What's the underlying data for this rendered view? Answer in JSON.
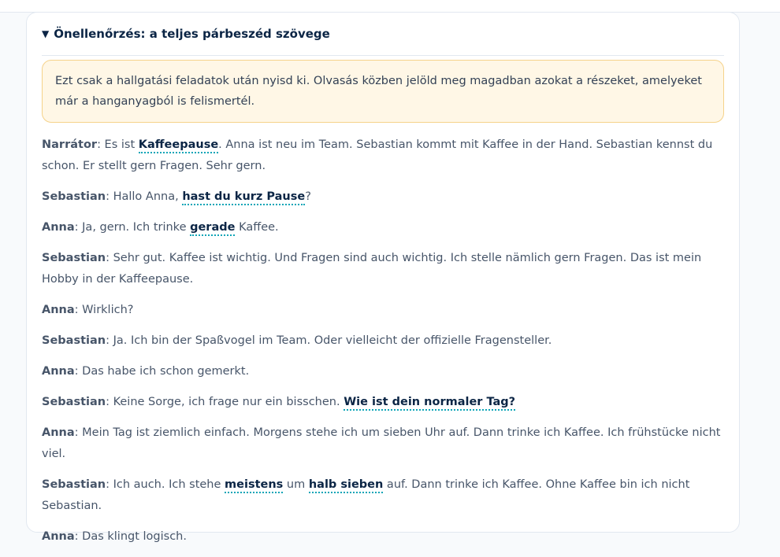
{
  "details": {
    "triangle": "▼",
    "title": "Önellenőrzés: a teljes párbeszéd szövege"
  },
  "note": "Ezt csak a hallgatási feladatok után nyisd ki. Olvasás közben jelöld meg magadban azokat a részeket, amelyeket már a hanganyagból is felismertél.",
  "dialog": [
    {
      "speaker": "Narrátor",
      "parts": [
        {
          "t": ": Es ist "
        },
        {
          "t": "Kaffeepause",
          "hl": true
        },
        {
          "t": ". Anna ist neu im Team. Sebastian kommt mit Kaffee in der Hand. Sebastian kennst du schon. Er stellt gern Fragen. Sehr gern."
        }
      ]
    },
    {
      "speaker": "Sebastian",
      "parts": [
        {
          "t": ": Hallo Anna, "
        },
        {
          "t": "hast du kurz Pause",
          "hl": true
        },
        {
          "t": "?"
        }
      ]
    },
    {
      "speaker": "Anna",
      "parts": [
        {
          "t": ": Ja, gern. Ich trinke "
        },
        {
          "t": "gerade",
          "hl": true
        },
        {
          "t": " Kaffee."
        }
      ]
    },
    {
      "speaker": "Sebastian",
      "parts": [
        {
          "t": ": Sehr gut. Kaffee ist wichtig. Und Fragen sind auch wichtig. Ich stelle nämlich gern Fragen. Das ist mein Hobby in der Kaffeepause."
        }
      ]
    },
    {
      "speaker": "Anna",
      "parts": [
        {
          "t": ": Wirklich?"
        }
      ]
    },
    {
      "speaker": "Sebastian",
      "parts": [
        {
          "t": ": Ja. Ich bin der Spaßvogel im Team. Oder vielleicht der offizielle Fragensteller."
        }
      ]
    },
    {
      "speaker": "Anna",
      "parts": [
        {
          "t": ": Das habe ich schon gemerkt."
        }
      ]
    },
    {
      "speaker": "Sebastian",
      "parts": [
        {
          "t": ": Keine Sorge, ich frage nur ein bisschen. "
        },
        {
          "t": "Wie ist dein normaler Tag?",
          "hl": true
        }
      ]
    },
    {
      "speaker": "Anna",
      "parts": [
        {
          "t": ": Mein Tag ist ziemlich einfach. Morgens stehe ich um sieben Uhr auf. Dann trinke ich Kaffee. Ich frühstücke nicht viel."
        }
      ]
    },
    {
      "speaker": "Sebastian",
      "parts": [
        {
          "t": ": Ich auch. Ich stehe "
        },
        {
          "t": "meistens",
          "hl": true
        },
        {
          "t": " um "
        },
        {
          "t": "halb sieben",
          "hl": true
        },
        {
          "t": " auf. Dann trinke ich Kaffee. Ohne Kaffee bin ich nicht Sebastian."
        }
      ]
    },
    {
      "speaker": "Anna",
      "parts": [
        {
          "t": ": Das klingt logisch."
        }
      ]
    }
  ]
}
